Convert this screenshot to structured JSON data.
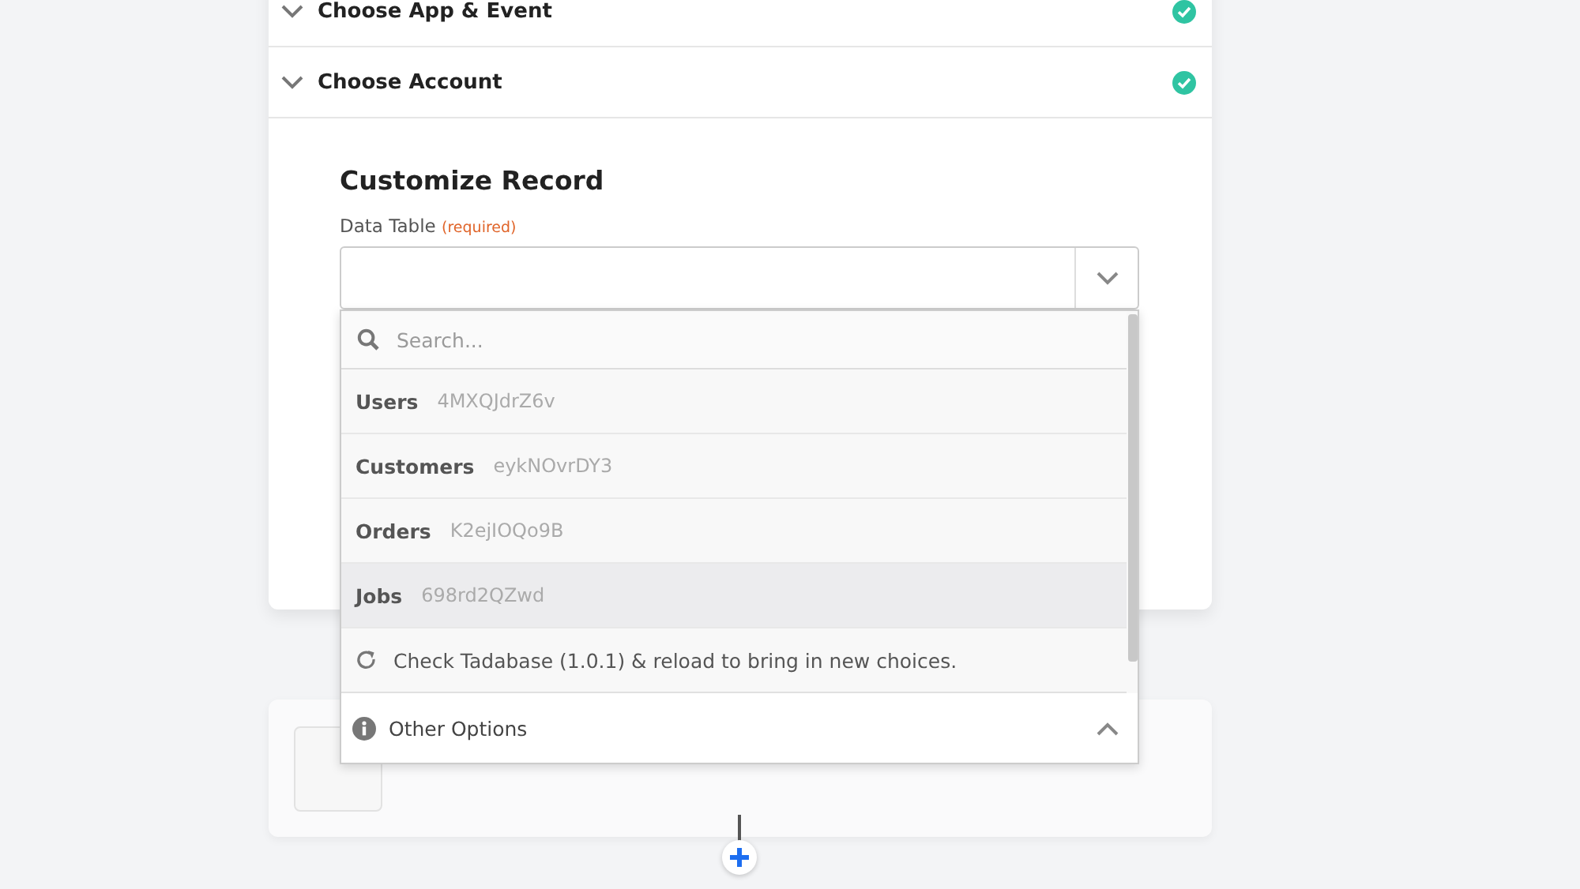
{
  "steps": [
    {
      "label": "Choose App & Event",
      "complete": true
    },
    {
      "label": "Choose Account",
      "complete": true
    }
  ],
  "section": {
    "title": "Customize Record",
    "field": {
      "label": "Data Table",
      "required": "(required)",
      "expanded": true,
      "search": {
        "placeholder": "Search..."
      },
      "options": [
        {
          "name": "Users",
          "id": "4MXQJdrZ6v",
          "highlighted": false
        },
        {
          "name": "Customers",
          "id": "eykNOvrDY3",
          "highlighted": false
        },
        {
          "name": "Orders",
          "id": "K2ejIOQo9B",
          "highlighted": false
        },
        {
          "name": "Jobs",
          "id": "698rd2QZwd",
          "highlighted": true
        }
      ],
      "reload": "Check Tadabase (1.0.1) & reload to bring in new choices.",
      "other_options": {
        "label": "Other Options",
        "expanded": true
      }
    }
  }
}
